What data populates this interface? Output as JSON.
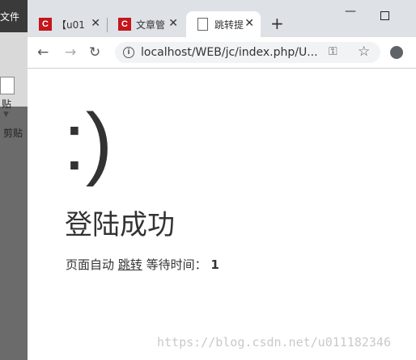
{
  "background_app": {
    "menu_label": "文件",
    "paste_label": "贴",
    "clipboard_label": "剪贴"
  },
  "browser": {
    "tabs": [
      {
        "title": "【u01",
        "favicon": "csdn-c-icon"
      },
      {
        "title": "文章管",
        "favicon": "csdn-c-icon"
      },
      {
        "title": "跳转提",
        "favicon": "document-icon",
        "active": true
      }
    ],
    "new_tab_symbol": "+",
    "address": "localhost/WEB/jc/index.php/U..."
  },
  "page": {
    "smiley": ":)",
    "headline": "登陆成功",
    "status_prefix": "页面自动",
    "jump_link": "跳转",
    "wait_label": "等待时间：",
    "wait_seconds": "1"
  },
  "watermark": "https://blog.csdn.net/u011182346",
  "colors": {
    "tabbar_bg": "#dee1e6",
    "csdn_red": "#c4161c",
    "text": "#333333"
  }
}
